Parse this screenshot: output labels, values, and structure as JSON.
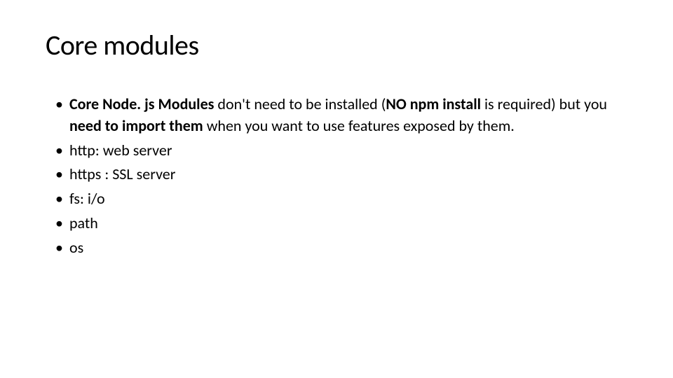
{
  "title": "Core modules",
  "bullets": {
    "b0": {
      "s0": "Core Node. js Modules",
      "s1": " don't need to be installed (",
      "s2": "NO npm install",
      "s3": " is required) but you ",
      "s4": "need to import them ",
      "s5": "when you want to use features exposed by them."
    },
    "b1": "http: web server",
    "b2": "https : SSL server",
    "b3": "fs: i/o",
    "b4": "path",
    "b5": "os"
  }
}
